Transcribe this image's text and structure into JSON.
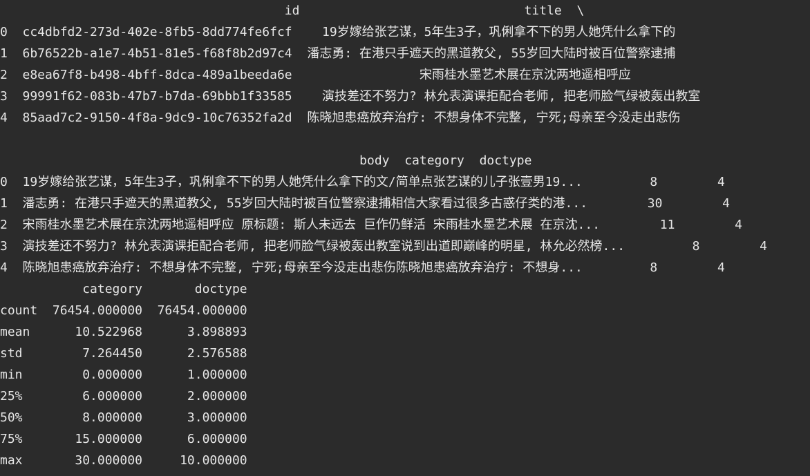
{
  "output": {
    "lines": [
      "                                      id                              title  \\",
      "0  cc4dbfd2-273d-402e-8fb5-8dd774fe6fcf    19岁嫁给张艺谋，5年生3子，巩俐拿不下的男人她凭什么拿下的",
      "1  6b76522b-a1e7-4b51-81e5-f68f8b2d97c4  潘志勇: 在港只手遮天的黑道教父, 55岁回大陆时被百位警察逮捕",
      "2  e8ea67f8-b498-4bff-8dca-489a1beeda6e                 宋雨桂水墨艺术展在京沈两地遥相呼应",
      "3  99991f62-083b-47b7-b7da-69bbb1f33585    演技差还不努力? 林允表演课拒配合老师, 把老师脸气绿被轰出教室",
      "4  85aad7c2-9150-4f8a-9dc9-10c76352fa2d  陈晓旭患癌放弃治疗: 不想身体不完整, 宁死;母亲至今没走出悲伤",
      "",
      "                                                body  category  doctype",
      "0  19岁嫁给张艺谋，5年生3子，巩俐拿不下的男人她凭什么拿下的文/简单点张艺谋的儿子张壹男19...         8        4",
      "1  潘志勇: 在港只手遮天的黑道教父, 55岁回大陆时被百位警察逮捕相信大家看过很多古惑仔类的港...        30        4",
      "2  宋雨桂水墨艺术展在京沈两地遥相呼应 原标题: 斯人未远去 巨作仍鲜活 宋雨桂水墨艺术展 在京沈...        11        4",
      "3  演技差还不努力? 林允表演课拒配合老师, 把老师脸气绿被轰出教室说到出道即巅峰的明星, 林允必然榜...         8        4",
      "4  陈晓旭患癌放弃治疗: 不想身体不完整, 宁死;母亲至今没走出悲伤陈晓旭患癌放弃治疗: 不想身...         8        4",
      "           category       doctype",
      "count  76454.000000  76454.000000",
      "mean      10.522968      3.898893",
      "std        7.264450      2.576588",
      "min        0.000000      1.000000",
      "25%        6.000000      2.000000",
      "50%        8.000000      3.000000",
      "75%       15.000000      6.000000",
      "max       30.000000     10.000000"
    ]
  }
}
